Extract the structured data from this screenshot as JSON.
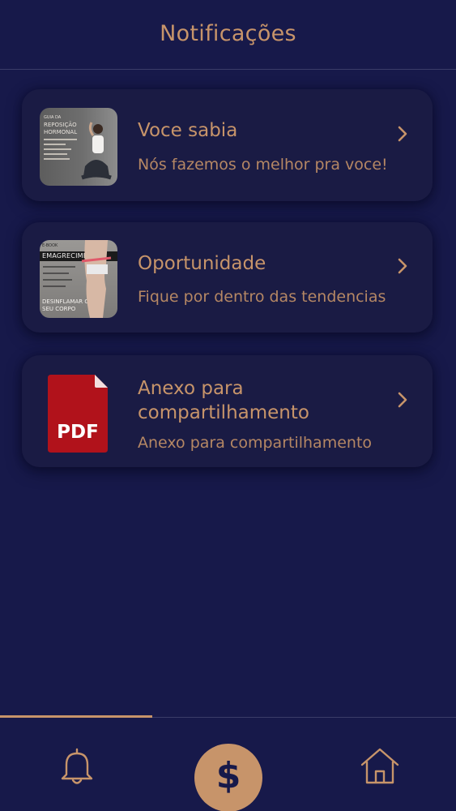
{
  "header": {
    "title": "Notificações"
  },
  "notifications": [
    {
      "title": "Voce sabia",
      "subtitle": "Nós fazemos o melhor pra voce!",
      "thumb_text_1": "GUIA DA",
      "thumb_text_2": "REPOSIÇÃO",
      "thumb_text_3": "HORMONAL",
      "thumbnail_icon": "hormone-guide-image"
    },
    {
      "title": "Oportunidade",
      "subtitle": "Fique por dentro das tendencias",
      "thumb_text_1": "E-BOOK",
      "thumb_text_2": "EMAGRECIMENTO",
      "thumb_text_3": "DESINFLAMAR O",
      "thumb_text_4": "SEU CORPO",
      "thumbnail_icon": "weight-loss-ebook-image"
    },
    {
      "title_line1": "Anexo para",
      "title_line2": "compartilhamento",
      "subtitle": "Anexo para compartilhamento",
      "thumb_text": "PDF",
      "thumbnail_icon": "pdf-file-icon"
    }
  ],
  "tabbar": {
    "items": [
      {
        "icon": "bell-icon",
        "active": true
      },
      {
        "icon": "dollar-icon",
        "label": "$"
      },
      {
        "icon": "home-icon"
      }
    ]
  },
  "colors": {
    "background": "#17194a",
    "accent": "#c7946a",
    "card": "#1a1b44",
    "pdf_red": "#b1121b"
  }
}
